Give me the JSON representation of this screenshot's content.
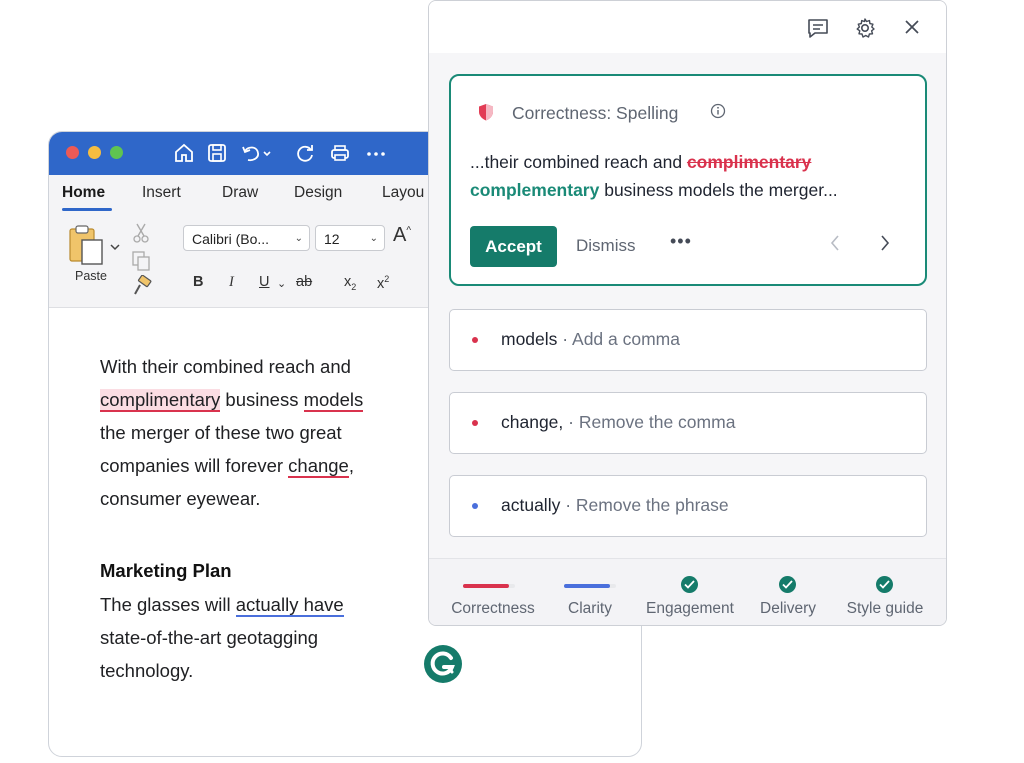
{
  "word": {
    "tabs": [
      "Home",
      "Insert",
      "Draw",
      "Design",
      "Layou"
    ],
    "paste_label": "Paste",
    "font_name": "Calibri (Bo...",
    "font_size": "12",
    "grow_font": "A",
    "format_buttons": [
      "B",
      "I",
      "U",
      "ab",
      "x",
      "x"
    ],
    "paragraph1": {
      "line1": "With their combined reach and",
      "w_complimentary": "complimentary",
      "w_business": " business ",
      "w_models": "models",
      "line3": "the merger of these two great",
      "line4_pre": "companies will forever ",
      "w_change": "change",
      "line4_post": ",",
      "line5": "consumer eyewear."
    },
    "heading": "Marketing Plan",
    "paragraph2": {
      "line1_pre": "The glasses will ",
      "w_actually": "actually have",
      "line2": "state-of-the-art geotagging",
      "line3": "technology."
    }
  },
  "panel": {
    "main_card": {
      "category": "Correctness: Spelling",
      "line1_pre": "...their combined reach and ",
      "wrong": "complimentary",
      "correct": "complementary",
      "line2_post": " business models the merger...",
      "accept": "Accept",
      "dismiss": "Dismiss",
      "more": "•••"
    },
    "cards": [
      {
        "word": "models",
        "sep": " · ",
        "action": "Add a comma",
        "color": "#d9324d"
      },
      {
        "word": "change,",
        "sep": " · ",
        "action": "Remove the comma",
        "color": "#d9324d"
      },
      {
        "word": "actually",
        "sep": " · ",
        "action": "Remove the phrase",
        "color": "#4a6fdc"
      }
    ],
    "metrics": [
      {
        "label": "Correctness",
        "state": "bar",
        "color": "#d9324d"
      },
      {
        "label": "Clarity",
        "state": "bar",
        "color": "#4a6fdc"
      },
      {
        "label": "Engagement",
        "state": "check"
      },
      {
        "label": "Delivery",
        "state": "check"
      },
      {
        "label": "Style guide",
        "state": "check"
      }
    ]
  },
  "colors": {
    "accent_green": "#157b6a",
    "error_red": "#d9324d",
    "clarity_blue": "#4a6fdc",
    "word_blue": "#2f67c9"
  }
}
